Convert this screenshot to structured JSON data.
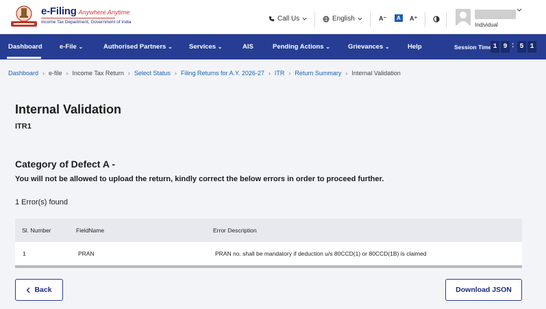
{
  "header": {
    "brand_main": "e-Filing",
    "brand_tagline": "Anywhere Anytime",
    "brand_sub": "Income Tax Department, Government of India",
    "call_us": "Call Us",
    "language": "English",
    "font_decrease": "A⁻",
    "font_normal": "A",
    "font_increase": "A⁺",
    "user_role": "Individual"
  },
  "nav": {
    "items": [
      "Dashboard",
      "e-File",
      "Authorised Partners",
      "Services",
      "AIS",
      "Pending Actions",
      "Grievances",
      "Help"
    ],
    "session_label": "Session Time",
    "session_digits": [
      "1",
      "9",
      "5",
      "1"
    ]
  },
  "breadcrumb": [
    "Dashboard",
    "e-file",
    "Income Tax Return",
    "Select Status",
    "Filing Returns for A.Y. 2026-27",
    "ITR",
    "Return Summary",
    "Internal Validation"
  ],
  "page": {
    "title": "Internal Validation",
    "subtitle": "ITR1",
    "defect_title": "Category of Defect A -",
    "defect_desc": "You will not be allowed to upload the return, kindly correct the below errors in order to proceed further.",
    "error_count": "1 Error(s) found"
  },
  "table": {
    "headers": [
      "Sl. Number",
      "FieldName",
      "Error Description"
    ],
    "rows": [
      [
        "1",
        "PRAN",
        "PRAN no. shall be mandatory if deduction u/s 80CCD(1) or 80CCD(1B) is claimed"
      ]
    ]
  },
  "buttons": {
    "back": "Back",
    "download": "Download JSON"
  },
  "colors": {
    "nav_bg": "#263d93",
    "link": "#1a5fb4",
    "brand_red": "#d23a3a"
  }
}
